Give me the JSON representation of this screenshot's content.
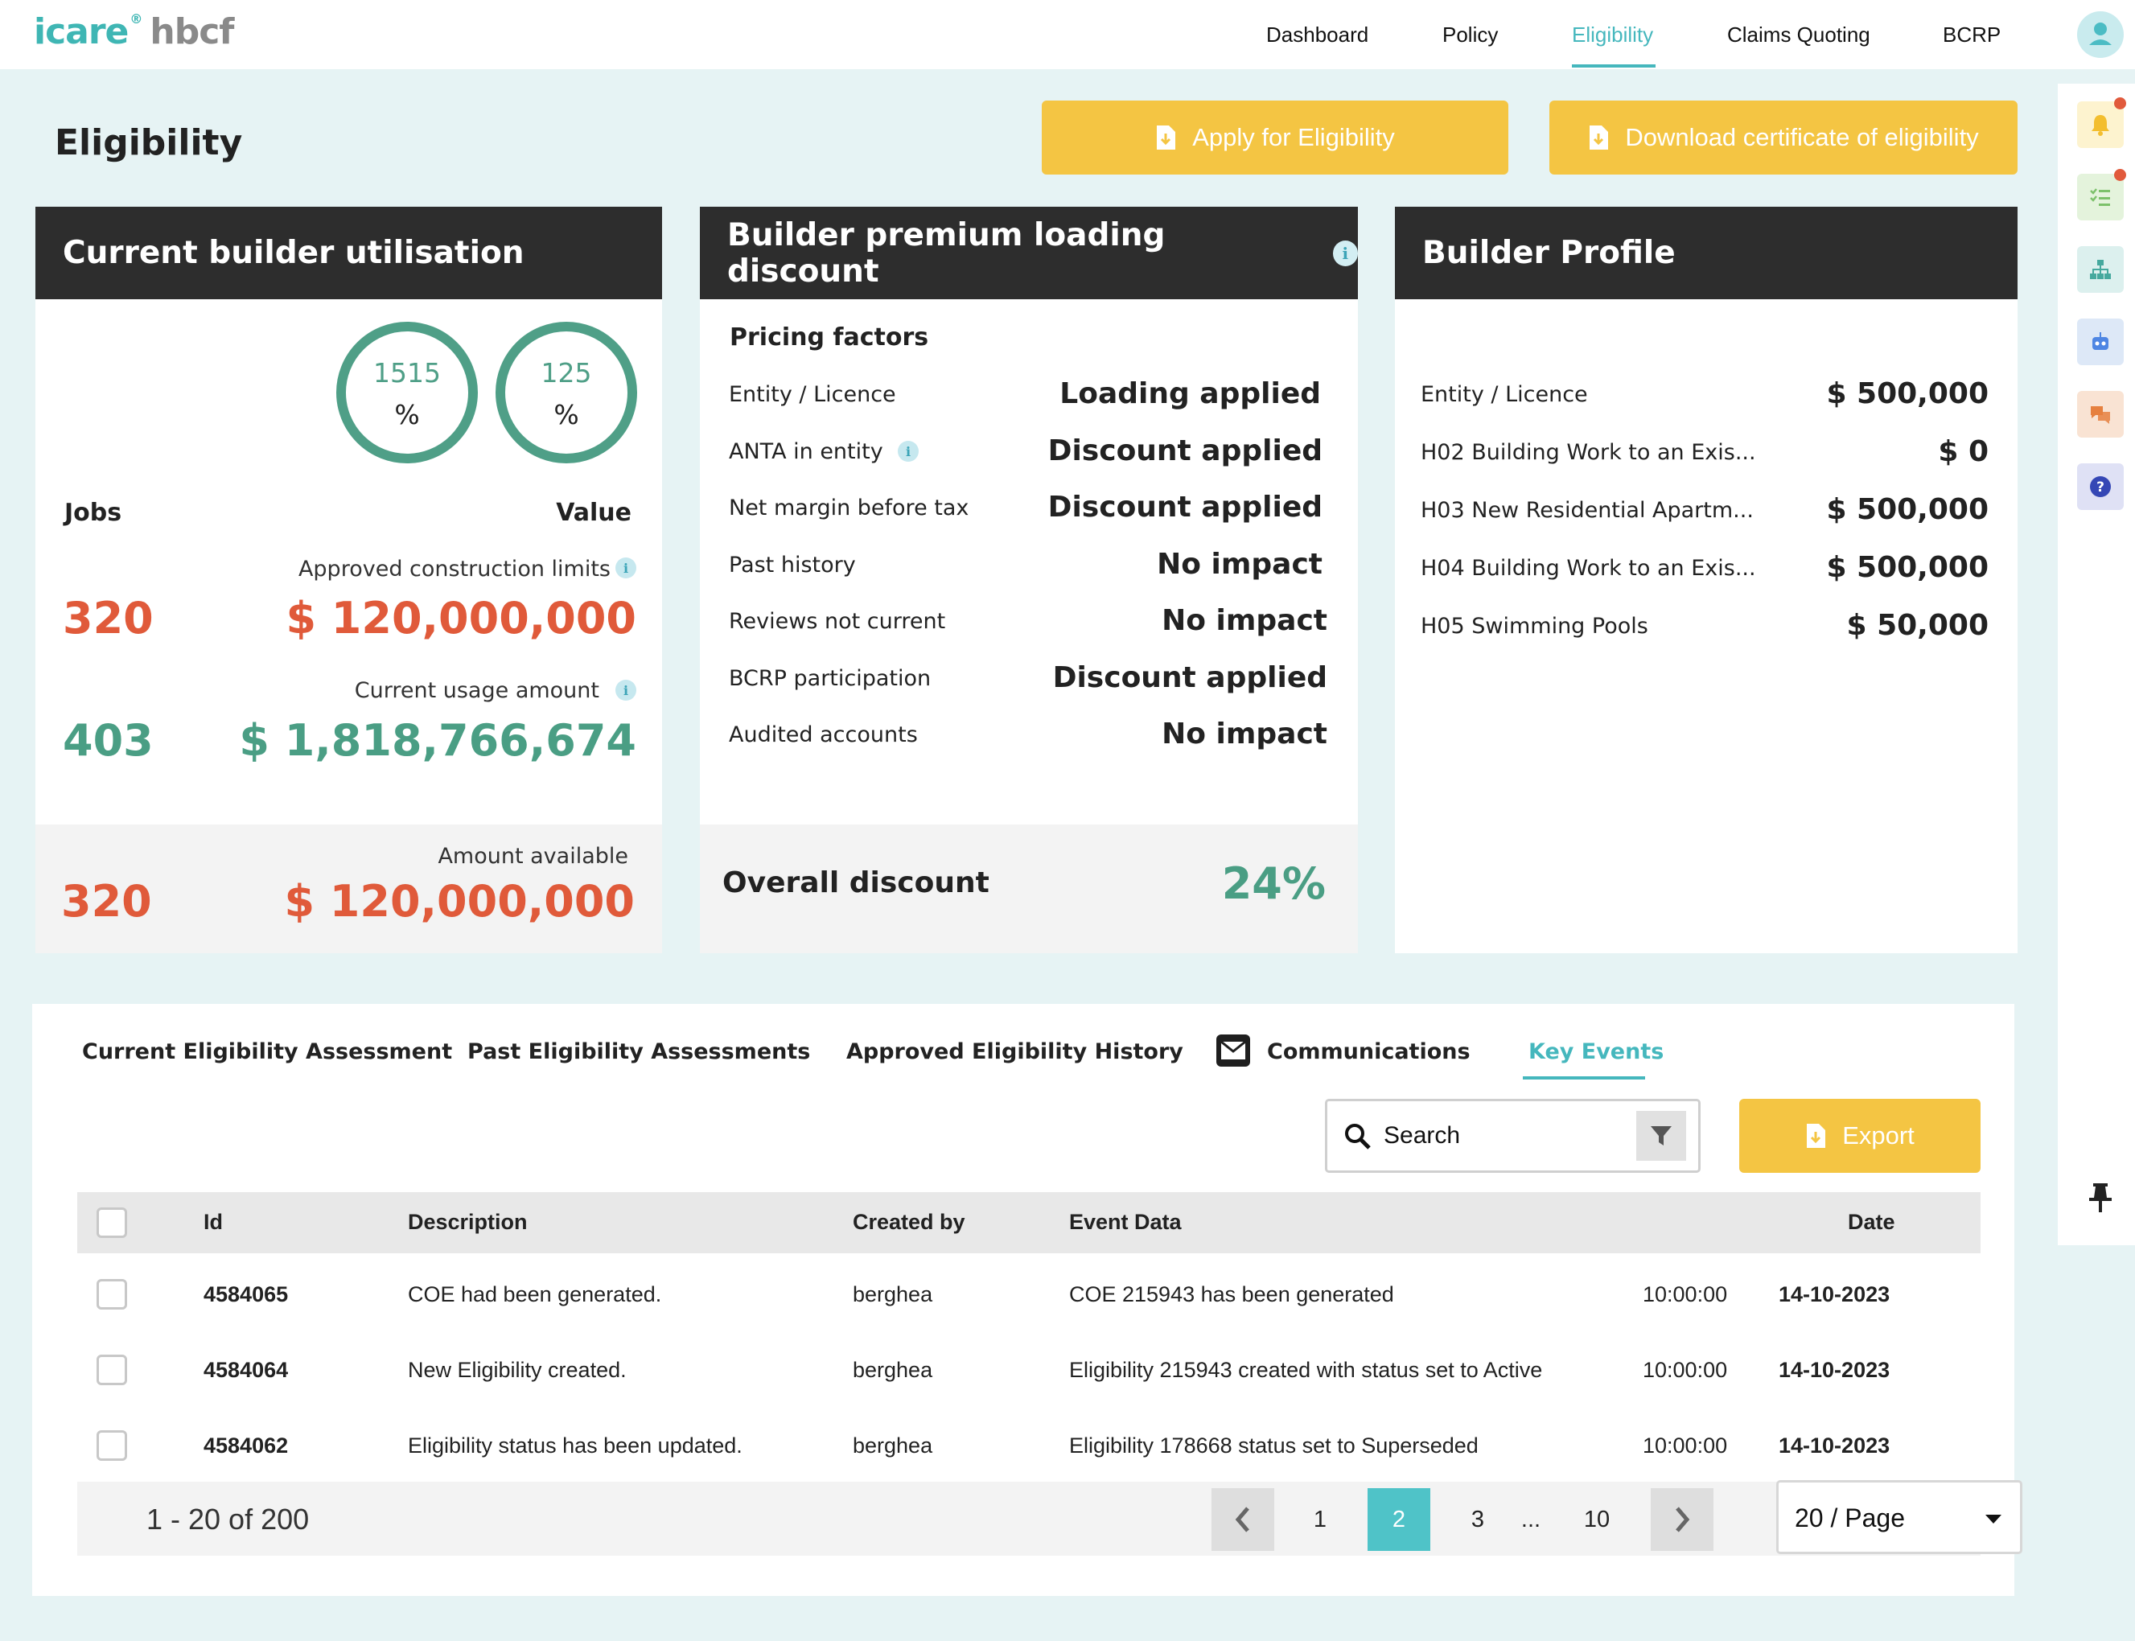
{
  "brand": {
    "name_a": "icare",
    "name_b": "hbcf"
  },
  "nav": {
    "items": [
      {
        "label": "Dashboard"
      },
      {
        "label": "Policy"
      },
      {
        "label": "Eligibility"
      },
      {
        "label": "Claims Quoting"
      },
      {
        "label": "BCRP"
      }
    ],
    "active": "Eligibility"
  },
  "page": {
    "title": "Eligibility"
  },
  "actions": {
    "apply_label": "Apply for Eligibility",
    "download_label": "Download certificate of eligibility"
  },
  "utilisation": {
    "title": "Current builder utilisation",
    "ring_jobs": {
      "value": "1515",
      "unit": "%"
    },
    "ring_value": {
      "value": "125",
      "unit": "%"
    },
    "jobs_label": "Jobs",
    "value_label": "Value",
    "approved_label": "Approved construction limits",
    "approved_jobs": "320",
    "approved_amount": "$ 120,000,000",
    "usage_label": "Current usage amount",
    "usage_jobs": "403",
    "usage_amount": "$ 1,818,766,674",
    "available_label": "Amount available",
    "available_jobs": "320",
    "available_amount": "$ 120,000,000"
  },
  "discount": {
    "title": "Builder premium loading discount",
    "pricing_factors_label": "Pricing factors",
    "factors": [
      {
        "label": "Entity / Licence",
        "value": "Loading applied"
      },
      {
        "label": "ANTA in entity",
        "value": "Discount applied"
      },
      {
        "label": "Net margin before tax",
        "value": "Discount applied"
      },
      {
        "label": "Past history",
        "value": "No impact"
      },
      {
        "label": "Reviews not current",
        "value": "No impact"
      },
      {
        "label": "BCRP participation",
        "value": "Discount applied"
      },
      {
        "label": "Audited accounts",
        "value": "No impact"
      }
    ],
    "overall_label": "Overall discount",
    "overall_value": "24%"
  },
  "profile": {
    "title": "Builder Profile",
    "rows": [
      {
        "label": "Entity / Licence",
        "value": "$ 500,000"
      },
      {
        "label": "H02 Building Work to an Exis...",
        "value": "$ 0"
      },
      {
        "label": "H03 New Residential Apartm...",
        "value": "$ 500,000"
      },
      {
        "label": "H04 Building Work to an Exis...",
        "value": "$ 500,000"
      },
      {
        "label": "H05 Swimming Pools",
        "value": "$ 50,000"
      }
    ]
  },
  "tabs": [
    {
      "label": "Current Eligibility Assessment"
    },
    {
      "label": "Past Eligibility Assessments"
    },
    {
      "label": "Approved Eligibility History"
    },
    {
      "label": "Communications"
    },
    {
      "label": "Key Events"
    }
  ],
  "active_tab": "Key Events",
  "search": {
    "placeholder": "Search"
  },
  "export_label": "Export",
  "table": {
    "headers": {
      "id": "Id",
      "description": "Description",
      "created_by": "Created by",
      "event_data": "Event Data",
      "date": "Date"
    },
    "rows": [
      {
        "id": "4584065",
        "description": "COE had been generated.",
        "created_by": "berghea",
        "event_data": "COE 215943 has been generated",
        "time": "10:00:00",
        "date": "14-10-2023"
      },
      {
        "id": "4584064",
        "description": "New Eligibility created.",
        "created_by": "berghea",
        "event_data": "Eligibility 215943 created with status set to Active",
        "time": "10:00:00",
        "date": "14-10-2023"
      },
      {
        "id": "4584062",
        "description": "Eligibility status has been updated.",
        "created_by": "berghea",
        "event_data": "Eligibility 178668 status set to Superseded",
        "time": "10:00:00",
        "date": "14-10-2023"
      }
    ]
  },
  "pagination": {
    "range_text": "1 - 20 of 200",
    "pages": [
      "1",
      "2",
      "3",
      "...",
      "10"
    ],
    "current": "2",
    "page_size": "20 / Page"
  },
  "colors": {
    "accent": "#45b7bd",
    "button_yellow": "#f4c543",
    "header_dark": "#2d2d2d",
    "red": "#e05a3a",
    "green": "#4a9e84"
  },
  "icons": [
    "bell-icon",
    "checklist-icon",
    "hierarchy-icon",
    "robot-icon",
    "chat-icon",
    "help-icon",
    "pin-icon",
    "search-icon",
    "filter-icon",
    "envelope-icon",
    "document-download-icon",
    "info-icon",
    "caret-down-icon",
    "chevron-left-icon",
    "chevron-right-icon",
    "user-icon"
  ]
}
